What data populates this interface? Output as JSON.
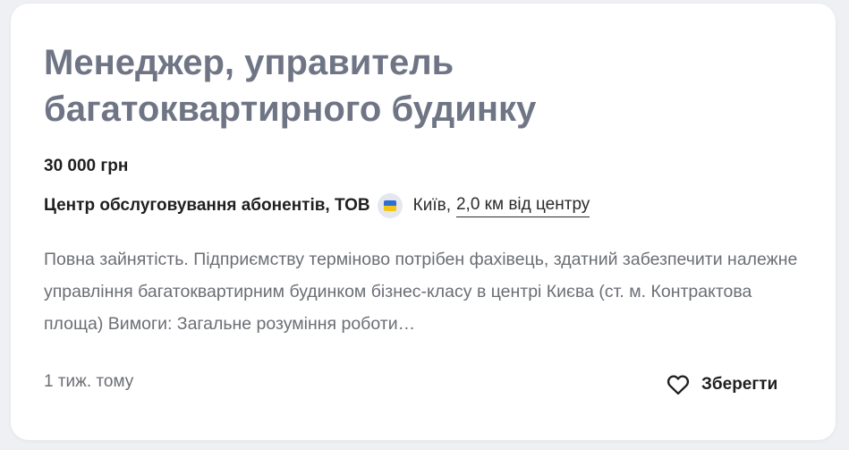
{
  "vacancy": {
    "title": "Менеджер, управитель багатоквартирного будинку",
    "salary": "30 000 грн",
    "company": "Центр обслуговування абонентів, ТОВ",
    "city": "Київ,",
    "distance": "2,0 км від центру",
    "description": "Повна зайнятість. Підприємству терміново потрібен фахівець, здатний забезпечити належне управління багатоквартирним будинком бізнес-класу в центрі Києва (ст. м. Контрактова площа) Вимоги: Загальне розуміння роботи…",
    "posted": "1 тиж. тому",
    "save_label": "Зберегти",
    "flag_icon": "ukraine-flag-icon",
    "save_icon": "heart-icon"
  },
  "colors": {
    "background": "#eef0f3",
    "card": "#ffffff",
    "title": "#6f7585",
    "text": "#1f1f1f",
    "muted": "#6b6e74",
    "flag_blue": "#2f6ed6",
    "flag_yellow": "#f2c613"
  }
}
